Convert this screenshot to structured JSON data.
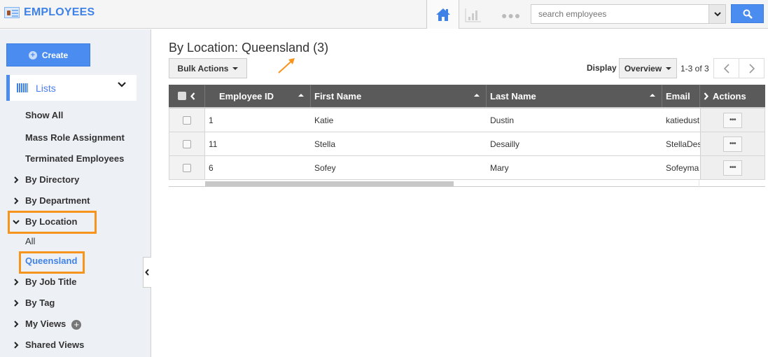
{
  "app": {
    "title": "EMPLOYEES"
  },
  "topnav": {
    "icons": [
      "home-icon",
      "chart-icon",
      "more-icon"
    ],
    "search": {
      "placeholder": "search employees",
      "value": ""
    }
  },
  "sidebar": {
    "create_label": "Create",
    "lists_label": "Lists",
    "items": [
      {
        "label": "Show All"
      },
      {
        "label": "Mass Role Assignment"
      },
      {
        "label": "Terminated Employees"
      },
      {
        "label": "By Directory"
      },
      {
        "label": "By Department"
      },
      {
        "label": "By Location"
      },
      {
        "label": "All"
      },
      {
        "label": "Queensland"
      },
      {
        "label": "By Job Title"
      },
      {
        "label": "By Tag"
      },
      {
        "label": "My Views"
      },
      {
        "label": "Shared Views"
      }
    ]
  },
  "main": {
    "title": "By Location: Queensland (3)",
    "bulk_actions_label": "Bulk Actions",
    "display_label": "Display",
    "display_value": "Overview",
    "range_text": "1-3 of 3",
    "columns": [
      "Employee ID",
      "First Name",
      "Last Name",
      "Email",
      "Actions"
    ],
    "rows": [
      {
        "id": "1",
        "first": "Katie",
        "last": "Dustin",
        "email": "katiedust"
      },
      {
        "id": "11",
        "first": "Stella",
        "last": "Desailly",
        "email": "StellaDes"
      },
      {
        "id": "6",
        "first": "Sofey",
        "last": "Mary",
        "email": "Sofeyma"
      }
    ]
  },
  "colors": {
    "accent": "#3f82e7",
    "highlight": "#f7941d",
    "header_bg": "#5a5a5a"
  }
}
